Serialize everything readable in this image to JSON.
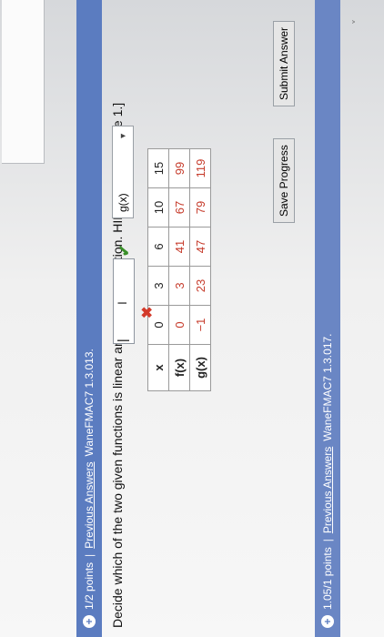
{
  "header1": {
    "points": "1/2 points",
    "separator": "|",
    "link": "Previous Answers",
    "code": "WaneFMAC7 1.3.013."
  },
  "question": "Decide which of the two given functions is linear and find its equation. HINT [See Example 1.]",
  "table": {
    "rows": [
      {
        "label": "x",
        "values": [
          "0",
          "3",
          "6",
          "10",
          "15"
        ]
      },
      {
        "label": "f(x)",
        "values": [
          "0",
          "3",
          "41",
          "67",
          "99"
        ]
      },
      {
        "label": "g(x)",
        "values": [
          "−1",
          "23",
          "47",
          "79",
          "119"
        ]
      }
    ]
  },
  "answer": {
    "select_value": "g(x)",
    "equals": "=",
    "input_value": "|"
  },
  "buttons": {
    "submit": "Submit Answer",
    "save": "Save Progress"
  },
  "header2": {
    "points": "1.05/1 points",
    "separator": "|",
    "link": "Previous Answers",
    "code": "WaneFMAC7 1.3.017."
  },
  "icons": {
    "plus": "plus-circle",
    "check": "check-icon",
    "x": "x-icon",
    "ibeam": "text-cursor-icon"
  },
  "colors": {
    "header": "#5b7cc0",
    "red_value": "#c63b2b",
    "check": "#3a8f2a",
    "wrong": "#d33a2a"
  }
}
